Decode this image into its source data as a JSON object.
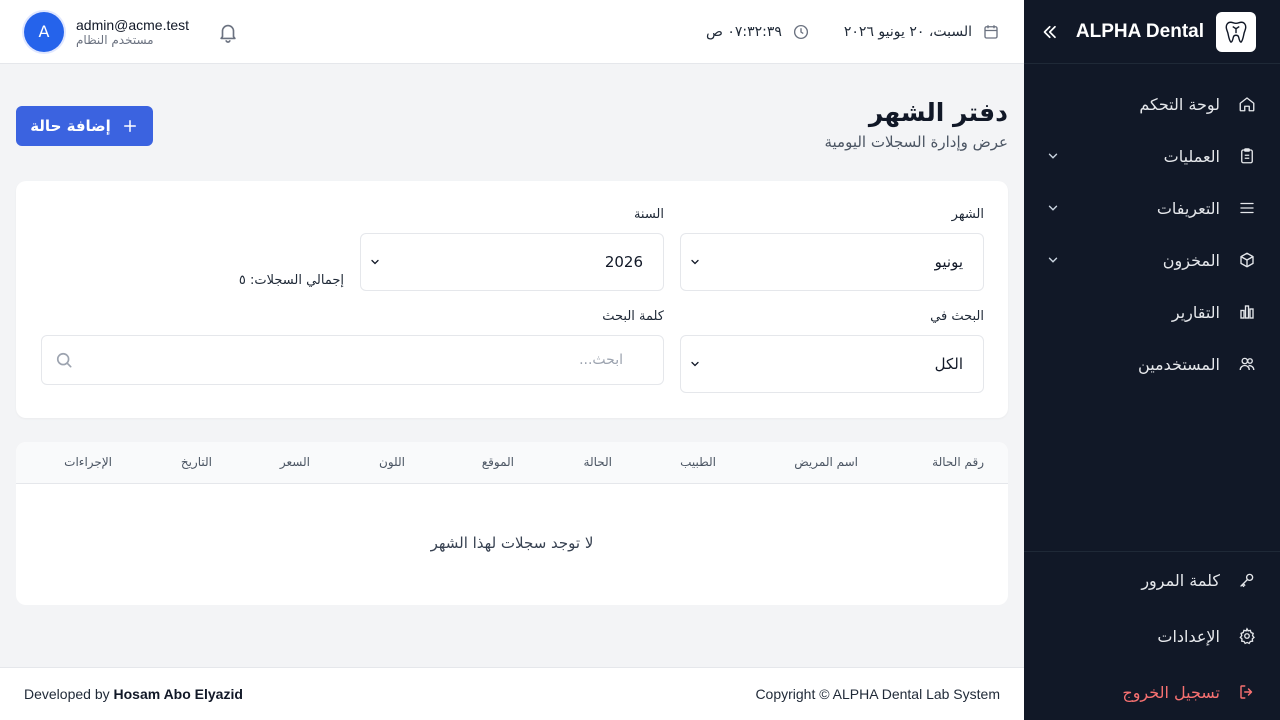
{
  "sidebar": {
    "brand": "ALPHA Dental",
    "items": [
      {
        "label": "لوحة التحكم",
        "icon": "home-icon"
      },
      {
        "label": "العمليات",
        "icon": "clipboard-icon",
        "expandable": true
      },
      {
        "label": "التعريفات",
        "icon": "list-icon",
        "expandable": true
      },
      {
        "label": "المخزون",
        "icon": "box-icon",
        "expandable": true
      },
      {
        "label": "التقارير",
        "icon": "chart-icon"
      },
      {
        "label": "المستخدمين",
        "icon": "users-icon"
      }
    ],
    "bottom": {
      "password": "كلمة المرور",
      "settings": "الإعدادات",
      "logout": "تسجيل الخروج"
    },
    "colors": {
      "background": "#111827",
      "logout": "#f87171"
    }
  },
  "header": {
    "date": "السبت، ٢٠ يونيو ٢٠٢٦",
    "time": "٠٧:٣٢:٣٩ ص",
    "user_email": "admin@acme.test",
    "user_role": "مستخدم النظام",
    "avatar_letter": "A"
  },
  "page": {
    "title": "دفتر الشهر",
    "subtitle": "عرض وإدارة السجلات اليومية",
    "add_button": "إضافة حالة"
  },
  "filters": {
    "month_label": "الشهر",
    "month_value": "يونيو",
    "year_label": "السنة",
    "year_value": "2026",
    "total_label": "إجمالي السجلات: ٥",
    "search_in_label": "البحث في",
    "search_in_value": "الكل",
    "keyword_label": "كلمة البحث",
    "keyword_placeholder": "ابحث..."
  },
  "table": {
    "columns": [
      "رقم الحالة",
      "اسم المريض",
      "الطبيب",
      "الحالة",
      "الموقع",
      "اللون",
      "السعر",
      "التاريخ",
      "الإجراءات"
    ],
    "empty_message": "لا توجد سجلات لهذا الشهر"
  },
  "footer": {
    "copyright": "Copyright © ALPHA Dental Lab System",
    "developed_by": "Developed by",
    "developer": "Hosam Abo Elyazid"
  },
  "accent": "#3b63e0"
}
